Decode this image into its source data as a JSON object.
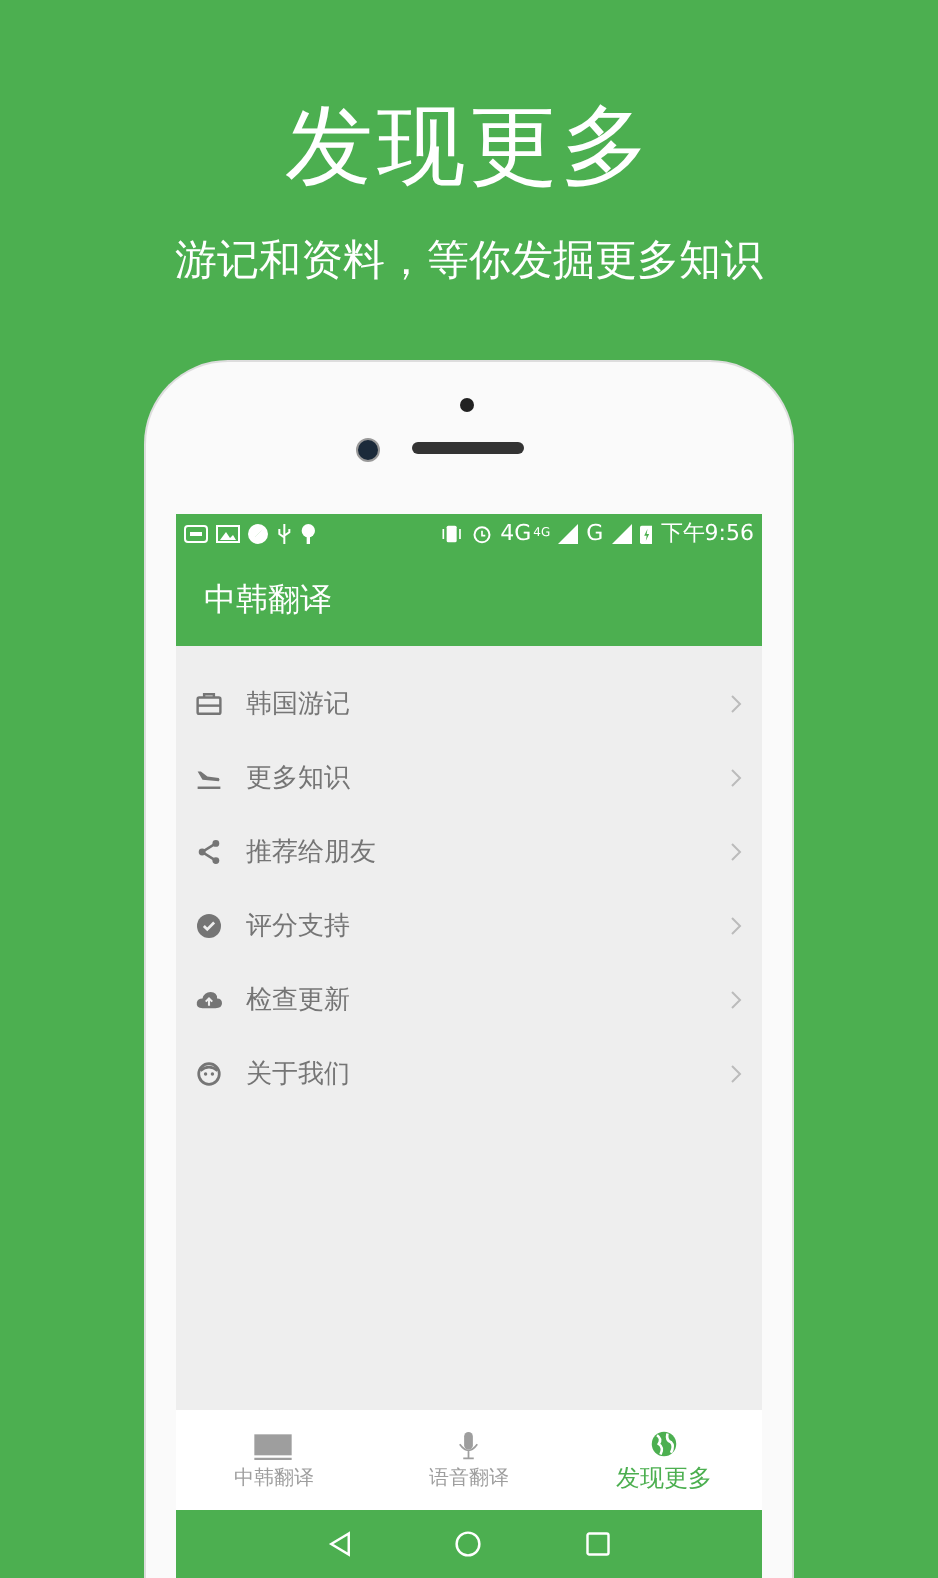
{
  "header": {
    "title": "发现更多",
    "subtitle": "游记和资料，等你发掘更多知识"
  },
  "status_bar": {
    "network": "4G",
    "network_sup": "4G",
    "network_2": "G",
    "time": "下午9:56"
  },
  "app_bar": {
    "title": "中韩翻译"
  },
  "menu": [
    {
      "kind": "briefcase",
      "label": "韩国游记"
    },
    {
      "kind": "plane",
      "label": "更多知识"
    },
    {
      "kind": "share",
      "label": "推荐给朋友"
    },
    {
      "kind": "check",
      "label": "评分支持"
    },
    {
      "kind": "cloud",
      "label": "检查更新"
    },
    {
      "kind": "face",
      "label": "关于我们"
    }
  ],
  "tabs": [
    {
      "kind": "keyboard",
      "label": "中韩翻译",
      "selected": false
    },
    {
      "kind": "mic",
      "label": "语音翻译",
      "selected": false
    },
    {
      "kind": "globe",
      "label": "发现更多",
      "selected": true
    }
  ]
}
